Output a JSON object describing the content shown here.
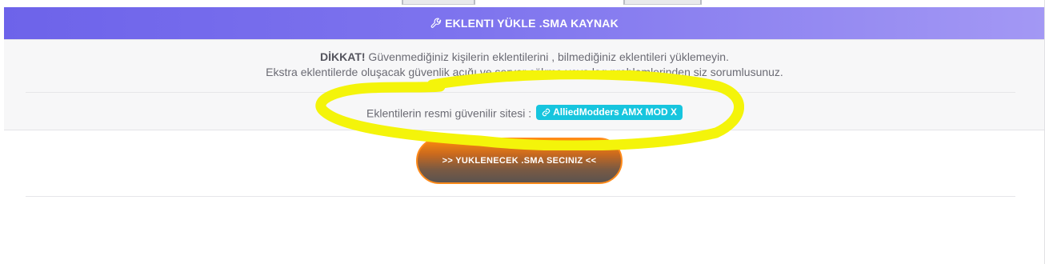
{
  "panel": {
    "title": "EKLENTI YÜKLE .SMA KAYNAK",
    "title_icon": "wrench-icon",
    "header_gradient": [
      "#6d63ea",
      "#a398f4"
    ]
  },
  "warning": {
    "bold": "DİKKAT!",
    "line1_rest": " Güvenmediğiniz kişilerin eklentilerini , bilmediğiniz eklentileri yüklemeyin.",
    "line2": "Ekstra eklentilerde oluşacak güvenlik açığı ve server çökme veya lag problemlerinden siz sorumlusunuz."
  },
  "official_site": {
    "label": "Eklentilerin resmi güvenilir sitesi :",
    "link_text": "AlliedModders AMX MOD X",
    "link_icon": "link-icon",
    "badge_color": "#17c5de"
  },
  "upload": {
    "button_label": ">> YUKLENECEK .SMA SECINIZ <<",
    "accent": "#ff8c0c"
  },
  "annotation": {
    "highlight_color": "#f4f40a"
  }
}
